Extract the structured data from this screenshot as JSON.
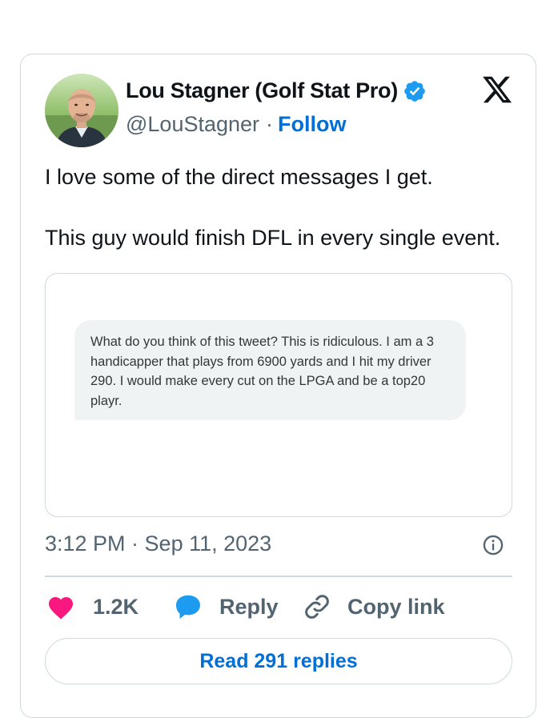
{
  "author": {
    "display_name": "Lou Stagner (Golf Stat Pro)",
    "handle": "@LouStagner",
    "separator": "·",
    "follow_label": "Follow",
    "verified_color": "#1d9bf0"
  },
  "platform_logo": "x-logo-icon",
  "tweet": {
    "line1": "I love some of the direct messages I get.",
    "line2": "This guy would finish DFL in every single event."
  },
  "media": {
    "dm_message": "What do you think of this tweet? This is ridiculous. I am a 3 handicapper that plays from 6900 yards and I hit my driver 290. I would make every cut on the LPGA and be a top20 playr."
  },
  "timestamp": "3:12 PM · Sep 11, 2023",
  "actions": {
    "like_count": "1.2K",
    "reply_label": "Reply",
    "copy_link_label": "Copy link"
  },
  "read_replies_label": "Read 291 replies",
  "colors": {
    "accent": "#006fd6",
    "like": "#f91880",
    "reply": "#1d9bf0",
    "muted": "#536471",
    "border": "#cfd9de"
  }
}
